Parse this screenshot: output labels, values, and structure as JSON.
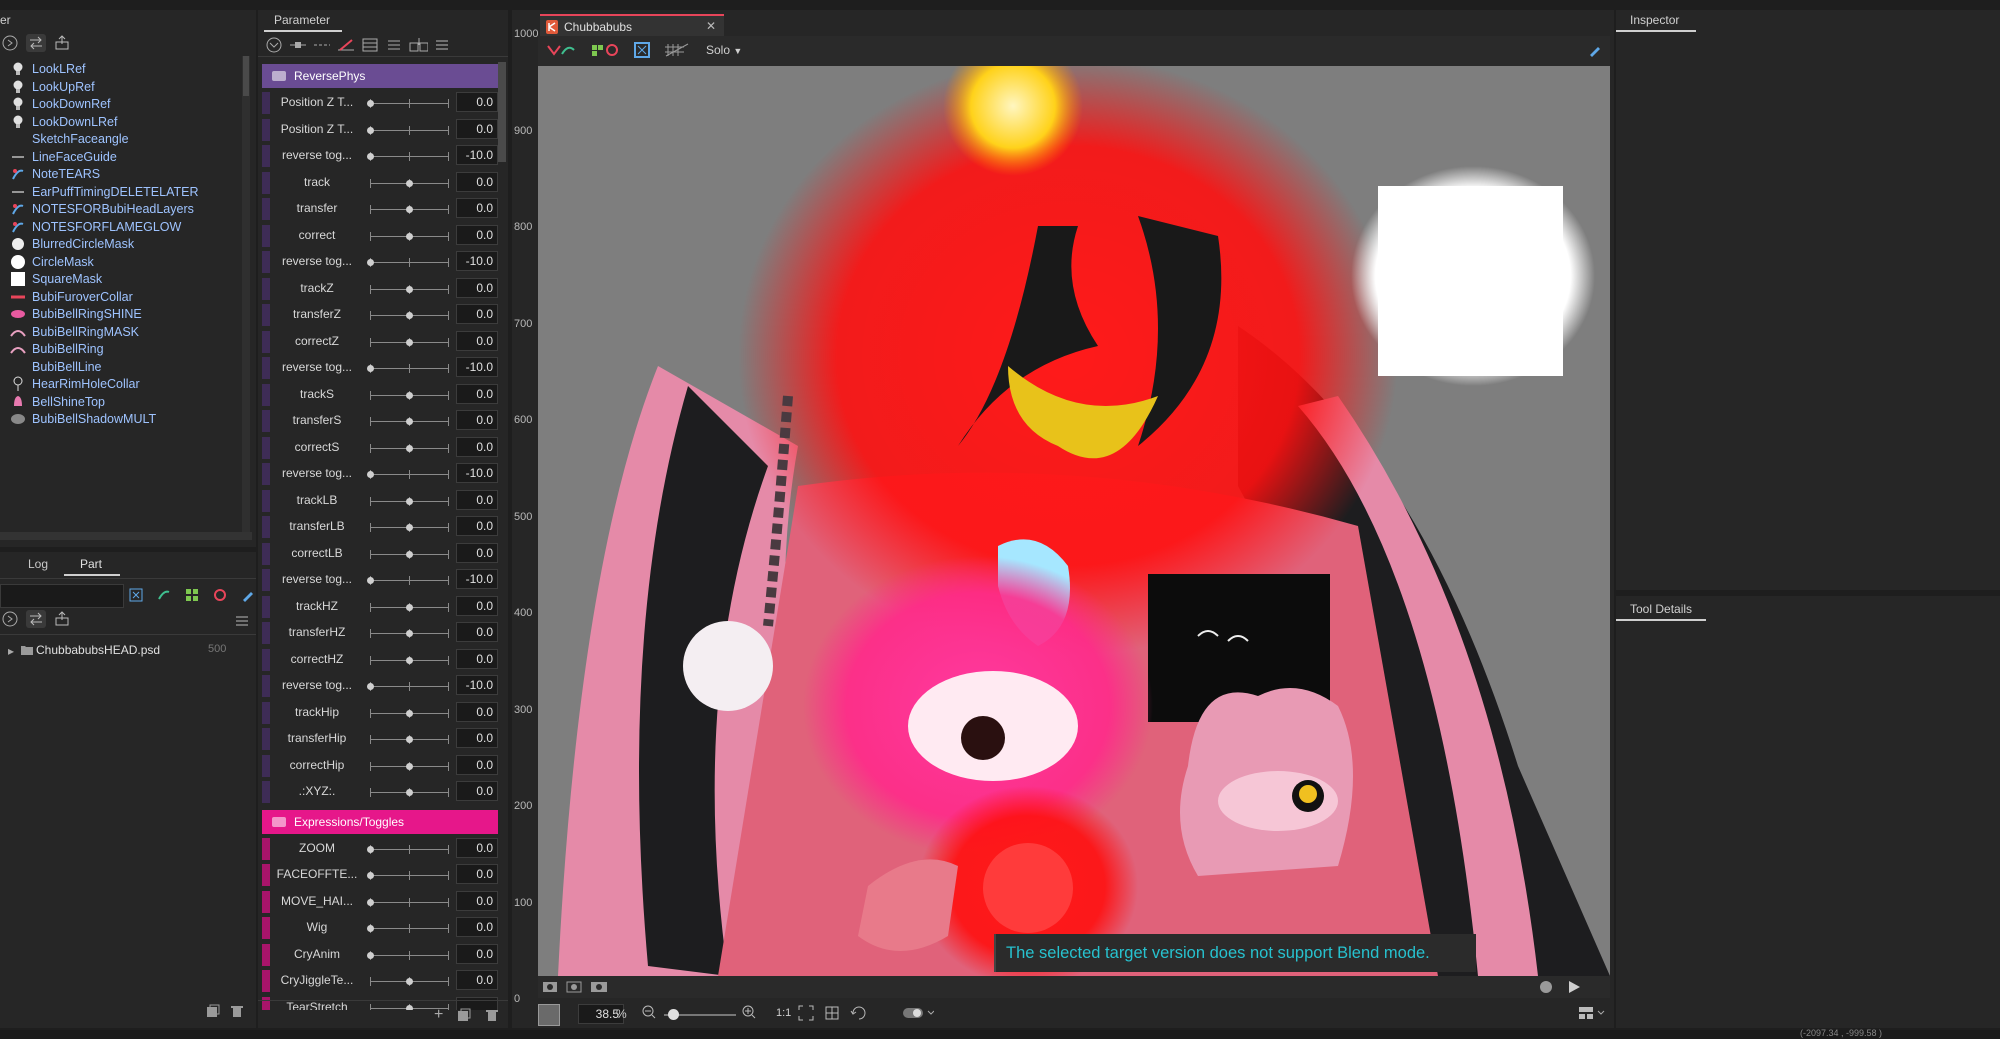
{
  "left_panel": {
    "title": "er",
    "layers": [
      {
        "name": "LookLRef",
        "icon": "bulb-icon"
      },
      {
        "name": "LookUpRef",
        "icon": "bulb-icon"
      },
      {
        "name": "LookDownRef",
        "icon": "bulb-icon"
      },
      {
        "name": "LookDownLRef",
        "icon": "bulb-icon"
      },
      {
        "name": "SketchFaceangle",
        "icon": "sketch-icon"
      },
      {
        "name": "LineFaceGuide",
        "icon": "line-icon"
      },
      {
        "name": "NoteTEARS",
        "icon": "note-icon"
      },
      {
        "name": "EarPuffTimingDELETELATER",
        "icon": "line-icon"
      },
      {
        "name": "NOTESFORBubiHeadLayers",
        "icon": "note-icon"
      },
      {
        "name": "NOTESFORFLAMEGLOW",
        "icon": "note-icon"
      },
      {
        "name": "BlurredCircleMask",
        "icon": "blur-circle-icon"
      },
      {
        "name": "CircleMask",
        "icon": "circle-icon"
      },
      {
        "name": "SquareMask",
        "icon": "square-icon"
      },
      {
        "name": "BubiFuroverCollar",
        "icon": "collar-icon"
      },
      {
        "name": "BubiBellRingSHINE",
        "icon": "ring-shine-icon"
      },
      {
        "name": "BubiBellRingMASK",
        "icon": "arc-icon"
      },
      {
        "name": "BubiBellRing",
        "icon": "arc-icon"
      },
      {
        "name": "BubiBellLine",
        "icon": "blank-icon"
      },
      {
        "name": "HearRimHoleCollar",
        "icon": "keyhole-icon"
      },
      {
        "name": "BellShineTop",
        "icon": "bell-icon"
      },
      {
        "name": "BubiBellShadowMULT",
        "icon": "shadow-icon"
      }
    ],
    "tabs": [
      "Log",
      "Part"
    ],
    "active_tab": "Part",
    "part_item": {
      "name": "ChubbabubsHEAD.psd",
      "value": "500"
    }
  },
  "parameter_panel": {
    "title": "Parameter",
    "groups": [
      {
        "name": "ReversePhys",
        "color": "#6a4c93",
        "params": [
          {
            "label": "Position Z T...",
            "value": "0.0",
            "knob": 0.0
          },
          {
            "label": "Position Z T...",
            "value": "0.0",
            "knob": 0.0
          },
          {
            "label": "reverse tog...",
            "value": "-10.0",
            "knob": 0.0
          },
          {
            "label": "track",
            "value": "0.0",
            "knob": 0.5
          },
          {
            "label": "transfer",
            "value": "0.0",
            "knob": 0.5
          },
          {
            "label": "correct",
            "value": "0.0",
            "knob": 0.5
          },
          {
            "label": "reverse tog...",
            "value": "-10.0",
            "knob": 0.0
          },
          {
            "label": "trackZ",
            "value": "0.0",
            "knob": 0.5
          },
          {
            "label": "transferZ",
            "value": "0.0",
            "knob": 0.5
          },
          {
            "label": "correctZ",
            "value": "0.0",
            "knob": 0.5
          },
          {
            "label": "reverse tog...",
            "value": "-10.0",
            "knob": 0.0
          },
          {
            "label": "trackS",
            "value": "0.0",
            "knob": 0.5
          },
          {
            "label": "transferS",
            "value": "0.0",
            "knob": 0.5
          },
          {
            "label": "correctS",
            "value": "0.0",
            "knob": 0.5
          },
          {
            "label": "reverse tog...",
            "value": "-10.0",
            "knob": 0.0
          },
          {
            "label": "trackLB",
            "value": "0.0",
            "knob": 0.5
          },
          {
            "label": "transferLB",
            "value": "0.0",
            "knob": 0.5
          },
          {
            "label": "correctLB",
            "value": "0.0",
            "knob": 0.5
          },
          {
            "label": "reverse tog...",
            "value": "-10.0",
            "knob": 0.0
          },
          {
            "label": "trackHZ",
            "value": "0.0",
            "knob": 0.5
          },
          {
            "label": "transferHZ",
            "value": "0.0",
            "knob": 0.5
          },
          {
            "label": "correctHZ",
            "value": "0.0",
            "knob": 0.5
          },
          {
            "label": "reverse tog...",
            "value": "-10.0",
            "knob": 0.0
          },
          {
            "label": "trackHip",
            "value": "0.0",
            "knob": 0.5
          },
          {
            "label": "transferHip",
            "value": "0.0",
            "knob": 0.5
          },
          {
            "label": "correctHip",
            "value": "0.0",
            "knob": 0.5
          },
          {
            "label": ".:XYZ:.",
            "value": "0.0",
            "knob": 0.5
          }
        ]
      },
      {
        "name": "Expressions/Toggles",
        "color": "#e6178a",
        "params": [
          {
            "label": "ZOOM",
            "value": "0.0",
            "knob": 0.0
          },
          {
            "label": "FACEOFFTE...",
            "value": "0.0",
            "knob": 0.0
          },
          {
            "label": "MOVE_HAI...",
            "value": "0.0",
            "knob": 0.0
          },
          {
            "label": "Wig",
            "value": "0.0",
            "knob": 0.0
          },
          {
            "label": "CryAnim",
            "value": "0.0",
            "knob": 0.0
          },
          {
            "label": "CryJiggleTe...",
            "value": "0.0",
            "knob": 0.5
          },
          {
            "label": "TearStretch",
            "value": "",
            "knob": 0.5
          }
        ]
      }
    ]
  },
  "canvas": {
    "tab_title": "Chubbabubs",
    "solo_label": "Solo",
    "ruler_labels": [
      "1000",
      "900",
      "800",
      "700",
      "600",
      "500",
      "400",
      "300",
      "200",
      "100",
      "0"
    ],
    "warning": "The selected target version does not support Blend mode.",
    "zoom_value": "38.5",
    "zoom_unit": "%",
    "ratio_label": "1:1",
    "zoom_slider": 0.12
  },
  "right_panels": {
    "inspector_title": "Inspector",
    "tool_details_title": "Tool Details"
  },
  "status_bar": {
    "text": "(-2097.34 , -999.58 )"
  },
  "colors": {
    "accent_purple": "#6a4c93",
    "accent_pink": "#e6178a",
    "layer_text": "#9ec3ff",
    "warning_text": "#27c2cf"
  }
}
